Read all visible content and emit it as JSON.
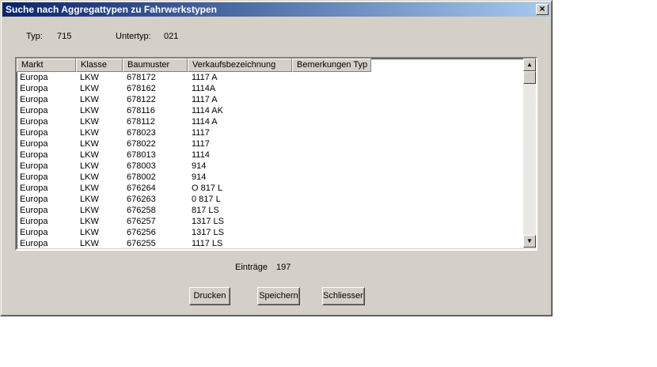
{
  "window": {
    "title": "Suche nach Aggregattypen zu Fahrwerkstypen",
    "close_label": "×"
  },
  "info": {
    "typ_label": "Typ:",
    "typ_value": "715",
    "untertyp_label": "Untertyp:",
    "untertyp_value": "021"
  },
  "table": {
    "columns": [
      "Markt",
      "Klasse",
      "Baumuster",
      "Verkaufsbezeichnung",
      "Bemerkungen Typ"
    ],
    "rows": [
      [
        "Europa",
        "LKW",
        "678172",
        "1117 A"
      ],
      [
        "Europa",
        "LKW",
        "678162",
        "1114A"
      ],
      [
        "Europa",
        "LKW",
        "678122",
        "1117 A"
      ],
      [
        "Europa",
        "LKW",
        "678116",
        "1114 AK"
      ],
      [
        "Europa",
        "LKW",
        "678112",
        "1114 A"
      ],
      [
        "Europa",
        "LKW",
        "678023",
        "1117"
      ],
      [
        "Europa",
        "LKW",
        "678022",
        "1117"
      ],
      [
        "Europa",
        "LKW",
        "678013",
        "1114"
      ],
      [
        "Europa",
        "LKW",
        "678003",
        "914"
      ],
      [
        "Europa",
        "LKW",
        "678002",
        "914"
      ],
      [
        "Europa",
        "LKW",
        "676264",
        "O 817 L"
      ],
      [
        "Europa",
        "LKW",
        "676263",
        "0 817 L"
      ],
      [
        "Europa",
        "LKW",
        "676258",
        "817 LS"
      ],
      [
        "Europa",
        "LKW",
        "676257",
        "1317 LS"
      ],
      [
        "Europa",
        "LKW",
        "676256",
        "1317 LS"
      ],
      [
        "Europa",
        "LKW",
        "676255",
        "1117 LS"
      ]
    ]
  },
  "scroll": {
    "up": "▲",
    "down": "▼"
  },
  "footer": {
    "eintraege_label": "Einträge",
    "eintraege_value": "197"
  },
  "buttons": {
    "print": "Drucken",
    "save": "Speichern",
    "close": "Schliessen"
  }
}
